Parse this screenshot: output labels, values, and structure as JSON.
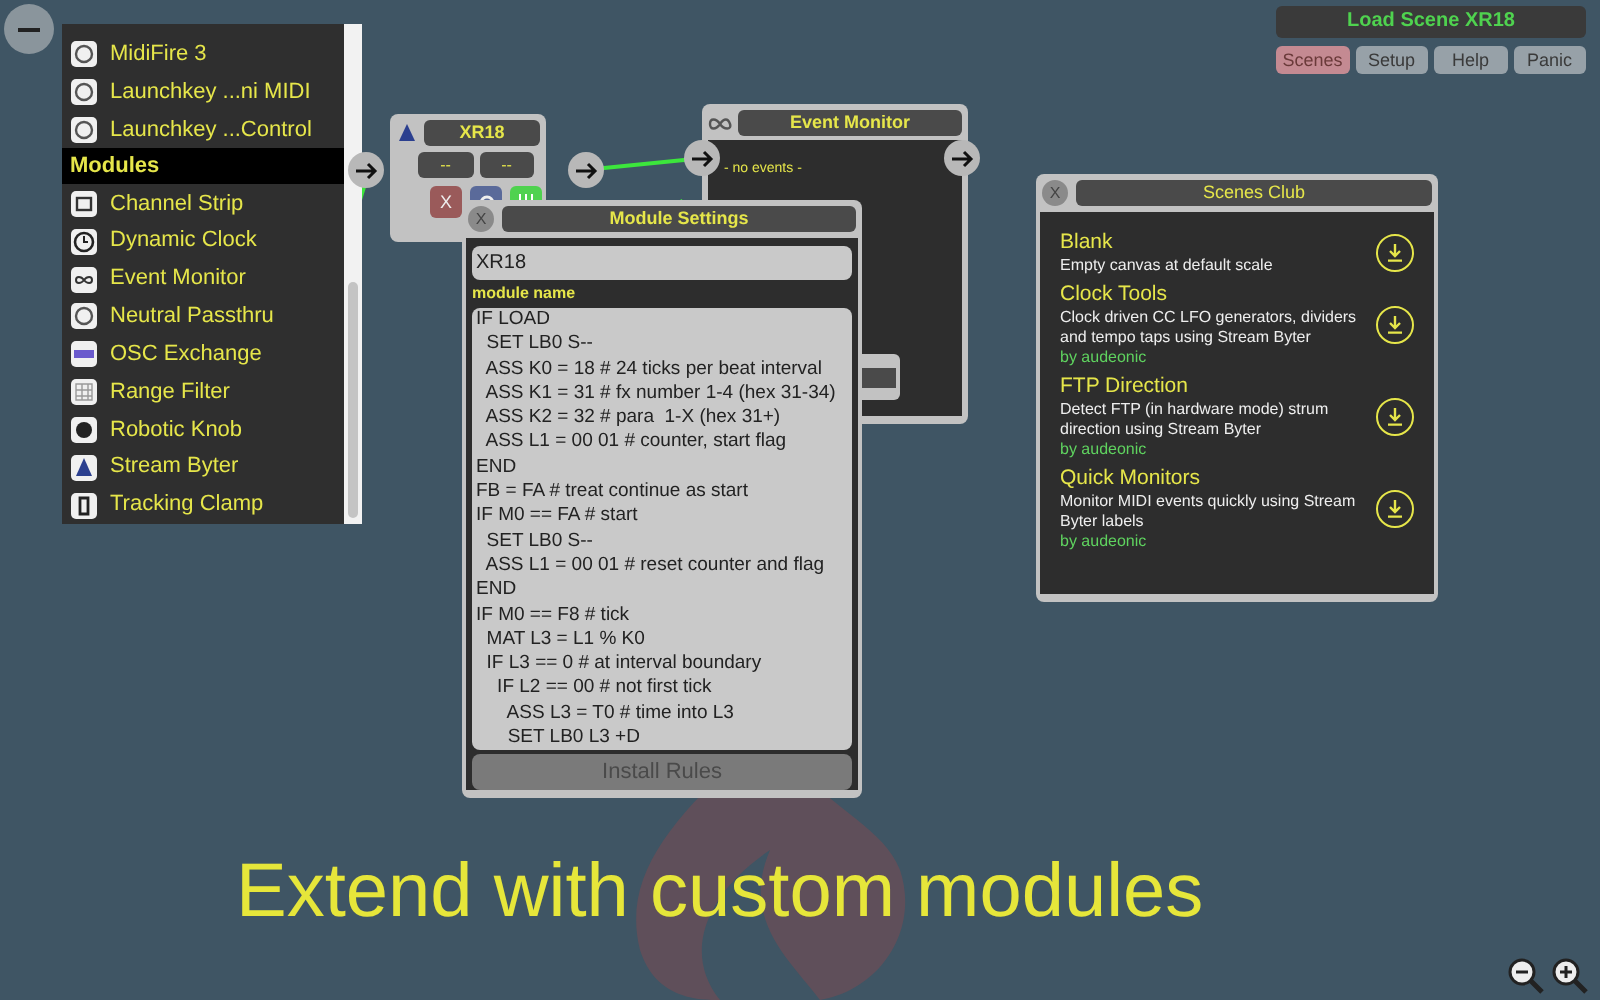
{
  "sidebar": {
    "items": [
      {
        "kind": "device",
        "label": "MidiFire 3"
      },
      {
        "kind": "device",
        "label": "Launchkey ...ni MIDI"
      },
      {
        "kind": "device",
        "label": "Launchkey ...Control"
      },
      {
        "kind": "header",
        "label": "Modules"
      },
      {
        "kind": "module",
        "label": "Channel Strip"
      },
      {
        "kind": "module",
        "label": "Dynamic Clock"
      },
      {
        "kind": "module",
        "label": "Event Monitor"
      },
      {
        "kind": "module",
        "label": "Neutral Passthru"
      },
      {
        "kind": "module",
        "label": "OSC Exchange"
      },
      {
        "kind": "module",
        "label": "Range Filter"
      },
      {
        "kind": "module",
        "label": "Robotic Knob"
      },
      {
        "kind": "module",
        "label": "Stream Byter"
      },
      {
        "kind": "module",
        "label": "Tracking Clamp"
      }
    ]
  },
  "toolbar": {
    "title": "Load Scene XR18",
    "buttons": [
      {
        "label": "Scenes",
        "selected": true
      },
      {
        "label": "Setup",
        "selected": false
      },
      {
        "label": "Help",
        "selected": false
      },
      {
        "label": "Panic",
        "selected": false
      }
    ]
  },
  "xr18_node": {
    "title": "XR18",
    "fields": [
      "--",
      "--"
    ],
    "close": "X"
  },
  "event_monitor": {
    "title": "Event Monitor",
    "status": "- no events -"
  },
  "module_settings": {
    "close": "X",
    "title": "Module Settings",
    "name_value": "XR18",
    "name_label": "module name",
    "code": [
      "IF LOAD",
      "  SET LB0 S--",
      "  ASS K0 = 18 # 24 ticks per beat interval",
      "  ASS K1 = 31 # fx number 1-4 (hex 31-34)",
      "  ASS K2 = 32 # para  1-X (hex 31+)",
      "  ASS L1 = 00 01 # counter, start flag",
      "END",
      "FB = FA # treat continue as start",
      "IF M0 == FA # start",
      "  SET LB0 S--",
      "  ASS L1 = 00 01 # reset counter and flag",
      "END",
      "IF M0 == F8 # tick",
      "  MAT L3 = L1 % K0",
      "  IF L3 == 0 # at interval boundary",
      "    IF L2 == 00 # not first tick",
      "      ASS L3 = T0 # time into L3",
      "      SET LB0 L3 +D"
    ],
    "button": {
      "label": "Install Rules",
      "disabled": true
    }
  },
  "scenes_club": {
    "close": "X",
    "title": "Scenes Club",
    "scenes": [
      {
        "title": "Blank",
        "description": "Empty canvas at default scale"
      },
      {
        "title": "Clock Tools",
        "description": "Clock driven CC LFO generators, dividers and tempo taps using Stream Byter",
        "author": "by audeonic"
      },
      {
        "title": "FTP Direction",
        "description": "Detect FTP (in hardware mode) strum direction using Stream Byter",
        "author": "by audeonic"
      },
      {
        "title": "Quick Monitors",
        "description": "Monitor MIDI events quickly using Stream Byter labels",
        "author": "by audeonic"
      }
    ]
  },
  "caption": "Extend with custom modules"
}
